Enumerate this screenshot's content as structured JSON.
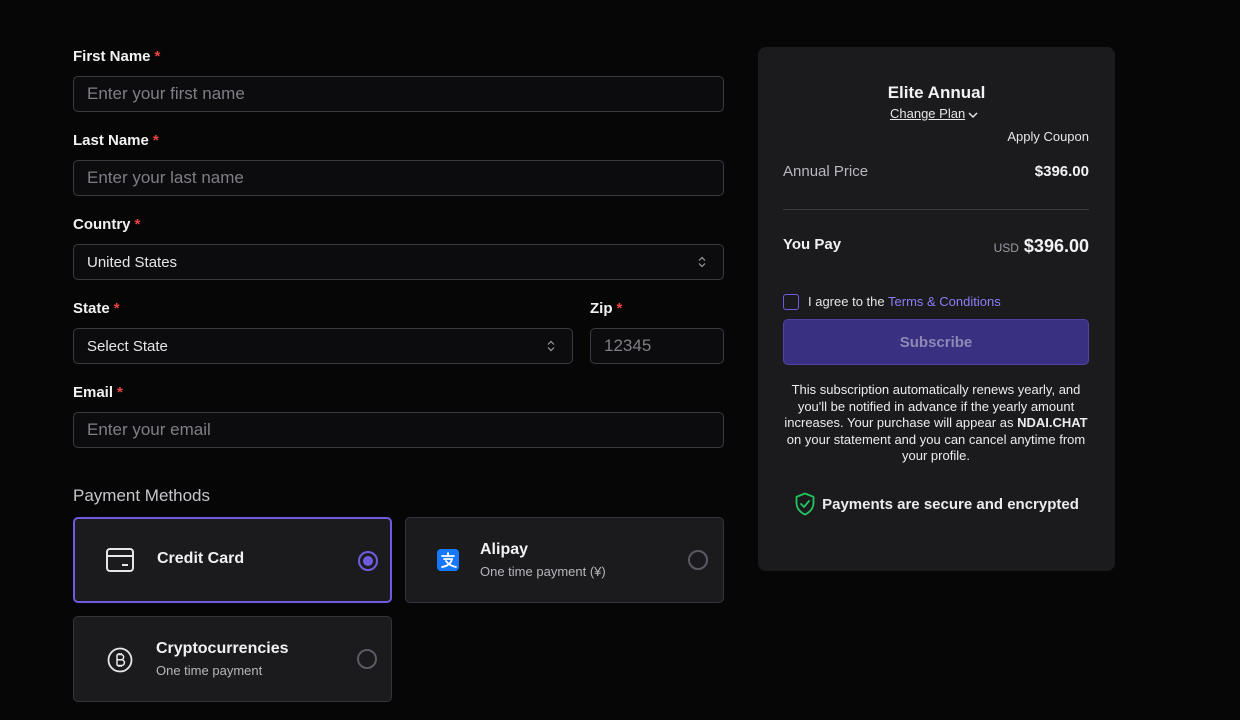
{
  "form": {
    "first_name": {
      "label": "First Name",
      "required": "*",
      "placeholder": "Enter your first name"
    },
    "last_name": {
      "label": "Last Name",
      "required": "*",
      "placeholder": "Enter your last name"
    },
    "country": {
      "label": "Country",
      "required": "*",
      "value": "United States"
    },
    "state": {
      "label": "State",
      "required": "*",
      "value": "Select State"
    },
    "zip": {
      "label": "Zip",
      "required": "*",
      "placeholder": "12345"
    },
    "email": {
      "label": "Email",
      "required": "*",
      "placeholder": "Enter your email"
    }
  },
  "payment": {
    "title": "Payment Methods",
    "methods": [
      {
        "name": "Credit Card",
        "sub": "",
        "icon": "credit-card-icon",
        "selected": true
      },
      {
        "name": "Alipay",
        "sub": "One time payment (¥)",
        "icon": "alipay-icon",
        "selected": false
      },
      {
        "name": "Cryptocurrencies",
        "sub": "One time payment",
        "icon": "bitcoin-icon",
        "selected": false
      }
    ]
  },
  "summary": {
    "plan_name": "Elite Annual",
    "change_plan": "Change Plan",
    "apply_coupon": "Apply Coupon",
    "annual_price_label": "Annual Price",
    "annual_price_value": "$396.00",
    "you_pay_label": "You Pay",
    "currency": "USD",
    "you_pay_value": "$396.00",
    "agree_text": "I agree to the",
    "terms_link": "Terms & Conditions",
    "subscribe": "Subscribe",
    "notice_part1": "This subscription automatically renews yearly, and you'll be notified in advance if the yearly amount increases. Your purchase will appear as",
    "notice_brand": "NDAI.CHAT",
    "notice_part2": "on your statement and you can cancel anytime from your profile.",
    "secure_text": "Payments are secure and encrypted"
  },
  "colors": {
    "accent": "#6d5ce0",
    "subscribe_bg": "#3a3082",
    "required": "#ef4444",
    "link": "#8b7ff5",
    "secure_icon": "#22c55e"
  }
}
